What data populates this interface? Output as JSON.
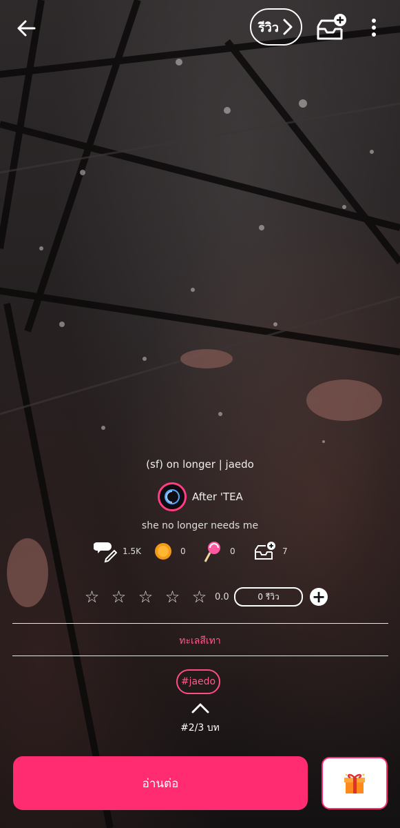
{
  "header": {
    "review_label": "รีวิว",
    "icons": [
      "arrow-left-icon",
      "chevron-right-icon",
      "bookshelf-add-icon",
      "more-vertical-icon"
    ]
  },
  "story": {
    "title": "(sf) on longer | jaedo",
    "author": "After 'TEA",
    "description": "she no longer needs me"
  },
  "stats": {
    "views": "1.5K",
    "coins": "0",
    "lollipops": "0",
    "shelf_adds": "7"
  },
  "rating": {
    "value": "0.0",
    "review_count_label": "0 รีวิว",
    "stars": 5,
    "filled": 0
  },
  "category": "ทะเลสีเทา",
  "tag": "#jaedo",
  "chapter": "#2/3 บท",
  "footer": {
    "read_label": "อ่านต่อ"
  },
  "colors": {
    "accent": "#ff2c72",
    "accent_text": "#ff5a8f"
  }
}
